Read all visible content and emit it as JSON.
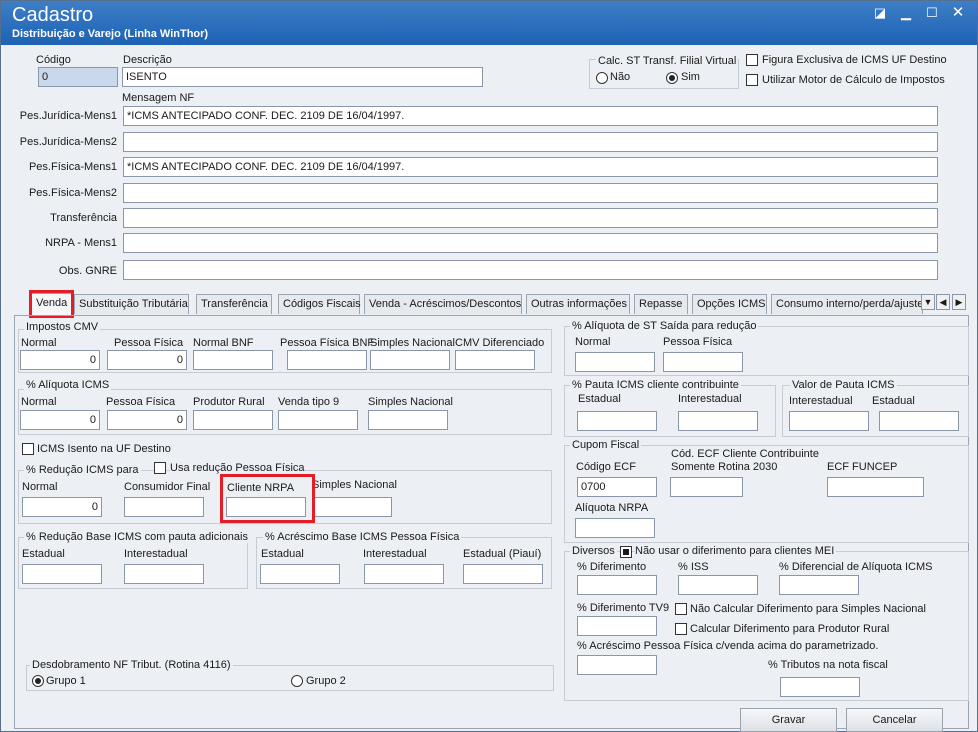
{
  "window": {
    "title": "Cadastro",
    "subtitle": "Distribuição e Varejo (Linha WinThor)"
  },
  "header": {
    "codigo_label": "Código",
    "codigo_value": "0",
    "descricao_label": "Descrição",
    "descricao_value": "ISENTO",
    "calc_st_label": "Calc. ST Transf. Filial Virtual",
    "radio_nao": "Não",
    "radio_sim": "Sim",
    "figura_exclusiva": "Figura Exclusiva de ICMS UF Destino",
    "utilizar_motor": "Utilizar Motor de Cálculo de Impostos",
    "mensagem_nf_label": "Mensagem NF"
  },
  "messages": [
    {
      "label": "Pes.Jurídica-Mens1",
      "value": "*ICMS ANTECIPADO CONF. DEC. 2109 DE 16/04/1997."
    },
    {
      "label": "Pes.Jurídica-Mens2",
      "value": ""
    },
    {
      "label": "Pes.Física-Mens1",
      "value": "*ICMS ANTECIPADO CONF. DEC. 2109 DE 16/04/1997."
    },
    {
      "label": "Pes.Física-Mens2",
      "value": ""
    },
    {
      "label": "Transferência",
      "value": ""
    },
    {
      "label": "NRPA - Mens1",
      "value": ""
    },
    {
      "label": "Obs. GNRE",
      "value": ""
    }
  ],
  "tabs": [
    "Venda",
    "Substituição Tributária",
    "Transferência",
    "Códigos Fiscais",
    "Venda - Acréscimos/Descontos",
    "Outras informações",
    "Repasse",
    "Opções ICMS",
    "Consumo interno/perda/ajuste"
  ],
  "impostos_cmv": {
    "title": "Impostos CMV",
    "labels": [
      "Normal",
      "Pessoa Física",
      "Normal BNF",
      "Pessoa Física BNF",
      "Simples Nacional",
      "CMV Diferenciado"
    ],
    "values": [
      "0",
      "0",
      "",
      "",
      "",
      ""
    ]
  },
  "aliquota_icms": {
    "title": "% Alíquota ICMS",
    "labels": [
      "Normal",
      "Pessoa Física",
      "Produtor Rural",
      "Venda tipo 9",
      "Simples Nacional"
    ],
    "values": [
      "0",
      "0",
      "",
      "",
      ""
    ]
  },
  "icms_isento_uf": "ICMS Isento na UF Destino",
  "reducao_icms": {
    "title": "% Redução ICMS para",
    "usa_reducao_pf": "Usa redução Pessoa Física",
    "labels": [
      "Normal",
      "Consumidor Final",
      "Cliente NRPA",
      "Simples Nacional"
    ],
    "values": [
      "0",
      "",
      "",
      ""
    ]
  },
  "reducao_base": {
    "title": "% Redução Base ICMS com pauta adicionais",
    "labels": [
      "Estadual",
      "Interestadual"
    ]
  },
  "acrescimo_base": {
    "title": "% Acréscimo Base ICMS Pessoa Física",
    "labels": [
      "Estadual",
      "Interestadual",
      "Estadual (Piauí)"
    ]
  },
  "desdobramento": {
    "title": "Desdobramento NF Tribut. (Rotina 4116)",
    "grupo1": "Grupo 1",
    "grupo2": "Grupo 2"
  },
  "aliquota_st": {
    "title": "% Alíquota de ST Saída para redução",
    "labels": [
      "Normal",
      "Pessoa Física"
    ]
  },
  "pauta_icms": {
    "title": "% Pauta ICMS cliente contribuinte",
    "labels": [
      "Estadual",
      "Interestadual"
    ]
  },
  "valor_pauta": {
    "title": "Valor de Pauta ICMS",
    "labels": [
      "Interestadual",
      "Estadual"
    ]
  },
  "cupom_fiscal": {
    "title": "Cupom Fiscal",
    "codigo_ecf_label": "Código ECF",
    "codigo_ecf_value": "0700",
    "cod_ecf_contrib_label": "Cód. ECF Cliente Contribuinte",
    "somente_rotina": "Somente Rotina 2030",
    "ecf_funcep": "ECF FUNCEP",
    "aliquota_nrpa": "Alíquota NRPA"
  },
  "diversos": {
    "title": "Diversos",
    "nao_usar_diferimento": "Não usar o diferimento para clientes MEI",
    "diferimento": "% Diferimento",
    "iss": "% ISS",
    "diferencial_aliquota": "% Diferencial de Alíquota ICMS",
    "diferimento_tv9": "% Diferimento TV9",
    "nao_calcular_simples": "Não Calcular Diferimento para Simples Nacional",
    "calcular_produtor": "Calcular Diferimento para Produtor Rural",
    "acrescimo_pf": "% Acréscimo Pessoa Física c/venda acima do parametrizado.",
    "tributos_nota": "% Tributos na nota fiscal"
  },
  "buttons": {
    "gravar": "Gravar",
    "cancelar": "Cancelar"
  },
  "colors": {
    "titlebar": "#1d62b4",
    "highlight": "#e41e26"
  }
}
